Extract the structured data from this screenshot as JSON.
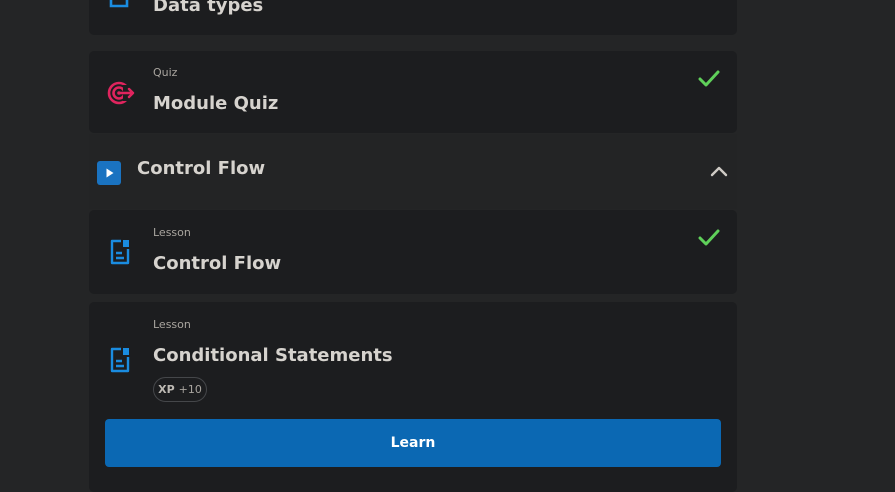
{
  "colors": {
    "background": "#242526",
    "card": "#1c1d1f",
    "lesson_icon": "#1a8ce0",
    "quiz_icon": "#e0245e",
    "check": "#5fd05a",
    "learn_button": "#0b68b3"
  },
  "items": [
    {
      "type": "",
      "title": "Data types",
      "icon": "document-icon",
      "completed": false
    },
    {
      "type": "Quiz",
      "title": "Module Quiz",
      "icon": "target-icon",
      "completed": true
    }
  ],
  "section": {
    "title": "Control Flow",
    "icon": "play-icon",
    "expanded": true,
    "items": [
      {
        "type": "Lesson",
        "title": "Control Flow",
        "icon": "document-icon",
        "completed": true
      },
      {
        "type": "Lesson",
        "title": "Conditional Statements",
        "icon": "document-icon",
        "completed": false,
        "xp_label": "XP",
        "xp_value": "+10",
        "action_label": "Learn"
      }
    ]
  }
}
